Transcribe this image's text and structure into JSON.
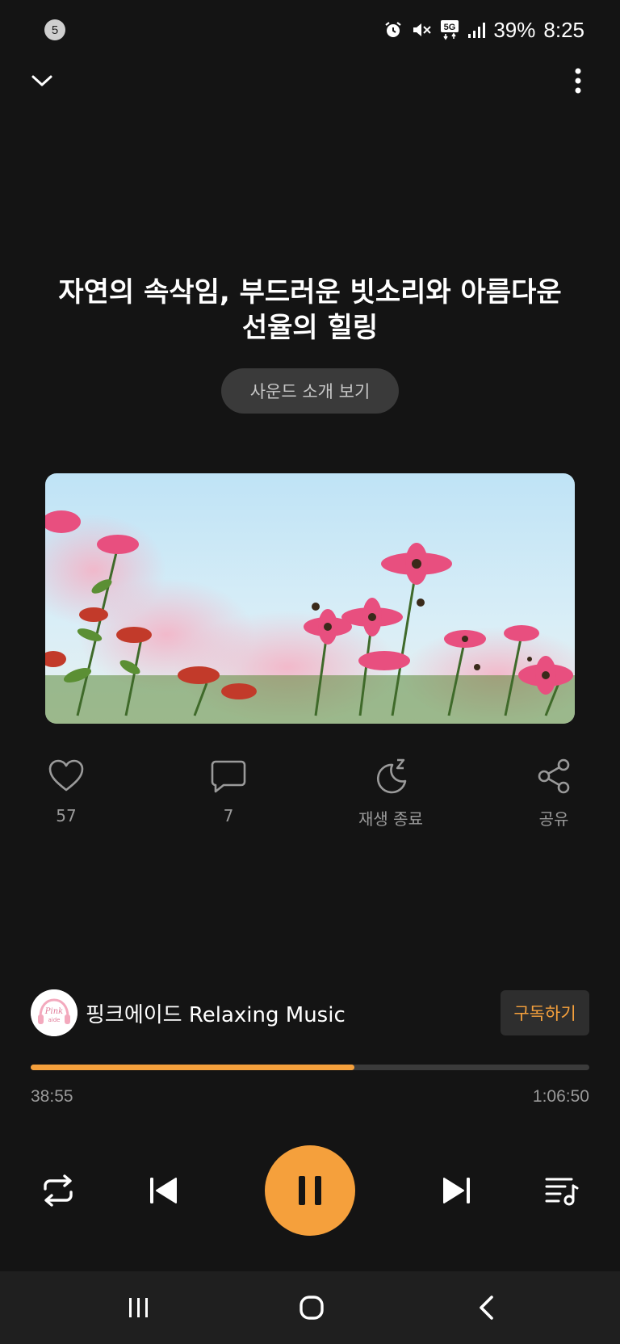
{
  "status_bar": {
    "notification_count": "5",
    "battery": "39%",
    "time": "8:25",
    "icons": [
      "alarm-icon",
      "mute-icon",
      "5g-icon",
      "signal-icon"
    ]
  },
  "top_bar": {
    "collapse_icon": "chevron-down-icon",
    "more_icon": "more-vertical-icon"
  },
  "track": {
    "title_line1": "자연의 속삭임, 부드러운 빗소리와 아름다운",
    "title_line2": "선율의 힐링",
    "intro_button": "사운드 소개 보기",
    "cover_image": "pink-cosmos-flowers-under-blue-sky"
  },
  "actions": {
    "like": {
      "icon": "heart-icon",
      "label": "57"
    },
    "comment": {
      "icon": "comment-icon",
      "label": "7"
    },
    "sleep": {
      "icon": "sleep-timer-icon",
      "label": "재생 종료"
    },
    "share": {
      "icon": "share-icon",
      "label": "공유"
    }
  },
  "channel": {
    "name": "핑크에이드 Relaxing Music",
    "avatar_text": "Pink aide",
    "subscribe_label": "구독하기"
  },
  "player": {
    "progress": 0.58,
    "elapsed": "38:55",
    "duration": "1:06:50",
    "controls": [
      "repeat-icon",
      "previous-icon",
      "pause-icon",
      "next-icon",
      "playlist-icon"
    ]
  },
  "colors": {
    "background": "#141414",
    "accent": "#f5a03c",
    "muted_text": "#9a9a9a"
  },
  "nav_bar": {
    "buttons": [
      "recent-apps-icon",
      "home-icon",
      "back-icon"
    ]
  }
}
